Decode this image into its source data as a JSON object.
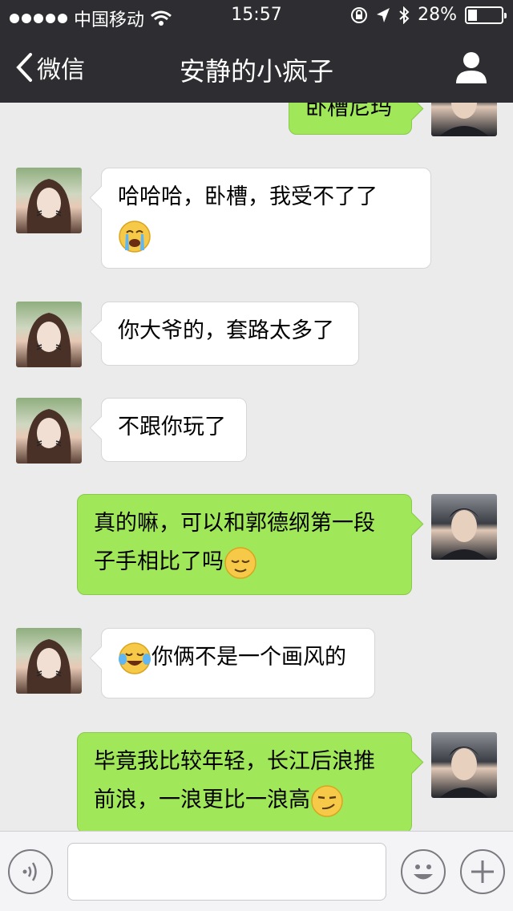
{
  "status_bar": {
    "carrier": "中国移动",
    "time": "15:57",
    "battery": "28%",
    "battery_level": 0.28
  },
  "nav": {
    "back_label": "微信",
    "title": "安静的小疯子"
  },
  "messages": [
    {
      "side": "out",
      "text": "卧槽尼玛",
      "emoji": null
    },
    {
      "side": "in",
      "text": "哈哈哈，卧槽，我受不了了",
      "emoji": "crying-face"
    },
    {
      "side": "in",
      "text": "你大爷的，套路太多了",
      "emoji": null
    },
    {
      "side": "in",
      "text": "不跟你玩了",
      "emoji": null
    },
    {
      "side": "out",
      "text_line1": "真的嘛，可以和郭德纲第一段",
      "text_line2": "子手相比了吗",
      "emoji": "relieved-face"
    },
    {
      "side": "in",
      "text": "你俩不是一个画风的",
      "emoji_before": "tears-of-joy-face"
    },
    {
      "side": "out",
      "text_line1": "毕竟我比较年轻，长江后浪推",
      "text_line2": "前浪，一浪更比一浪高",
      "emoji": "smirking-face"
    }
  ],
  "input_bar": {
    "message_value": "",
    "icons": [
      "voice-icon",
      "emoji-icon",
      "plus-icon"
    ]
  },
  "colors": {
    "nav_bg": "#2e2e32",
    "chat_bg": "#ebebeb",
    "outgoing_bubble": "#a0e75a",
    "incoming_bubble": "#ffffff"
  }
}
